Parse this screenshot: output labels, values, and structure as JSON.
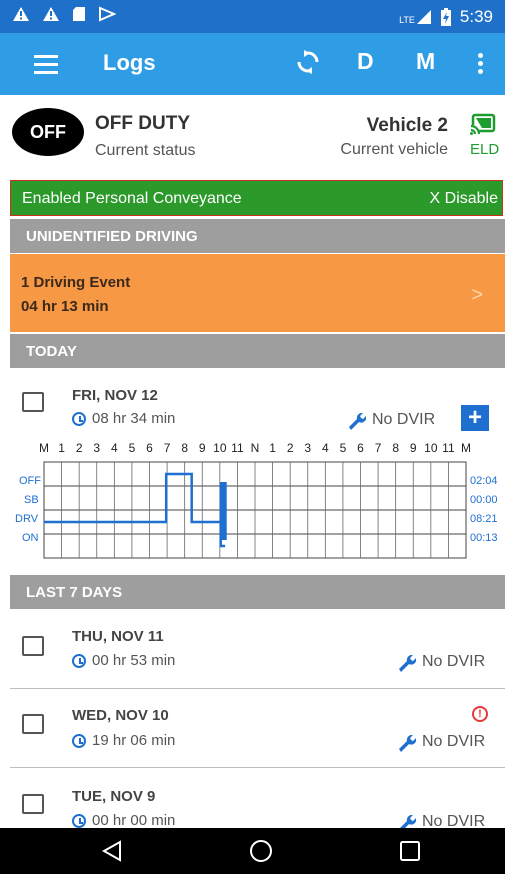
{
  "status_bar": {
    "left_icons": [
      "warning-icon",
      "warning-icon",
      "sd-card-icon",
      "play-icon"
    ],
    "network_label": "LTE",
    "time": "5:39"
  },
  "app_bar": {
    "title": "Logs",
    "sync_icon": "sync-icon",
    "d_label": "D",
    "m_label": "M",
    "menu_icon": "hamburger-icon",
    "more_icon": "more-vert-icon"
  },
  "status_card": {
    "badge": "OFF",
    "duty_title": "OFF DUTY",
    "duty_subtitle": "Current status",
    "vehicle_title": "Vehicle 2",
    "vehicle_subtitle": "Current vehicle",
    "eld_label": "ELD",
    "eld_icon": "cast-connected-icon"
  },
  "personal_conveyance": {
    "text": "Enabled Personal Conveyance",
    "disable_label": "X Disable"
  },
  "unidentified": {
    "header": "UNIDENTIFIED DRIVING",
    "events": "1 Driving Event",
    "duration": "04 hr  13 min",
    "chevron": ">"
  },
  "today": {
    "header": "TODAY",
    "day": {
      "date": "FRI, NOV 12",
      "duration": "08 hr  34 min",
      "dvir": "No DVIR",
      "add_label": "+"
    },
    "graph": {
      "hours": [
        "M",
        "1",
        "2",
        "3",
        "4",
        "5",
        "6",
        "7",
        "8",
        "9",
        "10",
        "11",
        "N",
        "1",
        "2",
        "3",
        "4",
        "5",
        "6",
        "7",
        "8",
        "9",
        "10",
        "11",
        "M"
      ],
      "rows": [
        "OFF",
        "SB",
        "DRV",
        "ON"
      ],
      "totals": [
        "02:04",
        "00:00",
        "08:21",
        "00:13"
      ],
      "segments": [
        {
          "status": 2,
          "start": 0,
          "end": 6.95
        },
        {
          "status": 0,
          "start": 6.95,
          "end": 8.4
        },
        {
          "status": 2,
          "start": 8.4,
          "end": 10.05
        },
        {
          "status": 3,
          "start": 10.05,
          "end": 10.3
        }
      ],
      "line_color": "#1f6fd0"
    }
  },
  "last7": {
    "header": "LAST 7 DAYS",
    "days": [
      {
        "date": "THU, NOV 11",
        "duration": "00 hr  53 min",
        "dvir": "No DVIR"
      },
      {
        "date": "WED, NOV 10",
        "duration": "19 hr  06 min",
        "dvir": "No DVIR",
        "alert": "!"
      },
      {
        "date": "TUE, NOV 9",
        "duration": "00 hr  00 min",
        "dvir": "No DVIR"
      }
    ]
  },
  "nav_bar": {
    "back_icon": "back-triangle-icon",
    "home_icon": "home-circle-icon",
    "recents_icon": "recents-square-icon"
  },
  "colors": {
    "status_bar": "#1f70c8",
    "app_bar": "#2f9ce6",
    "personal_conveyance": "#2b9a2b",
    "unidentified": "#f79845",
    "section_header": "#9e9e9e",
    "accent": "#1f6fd0",
    "eld": "#1d9d2f"
  }
}
